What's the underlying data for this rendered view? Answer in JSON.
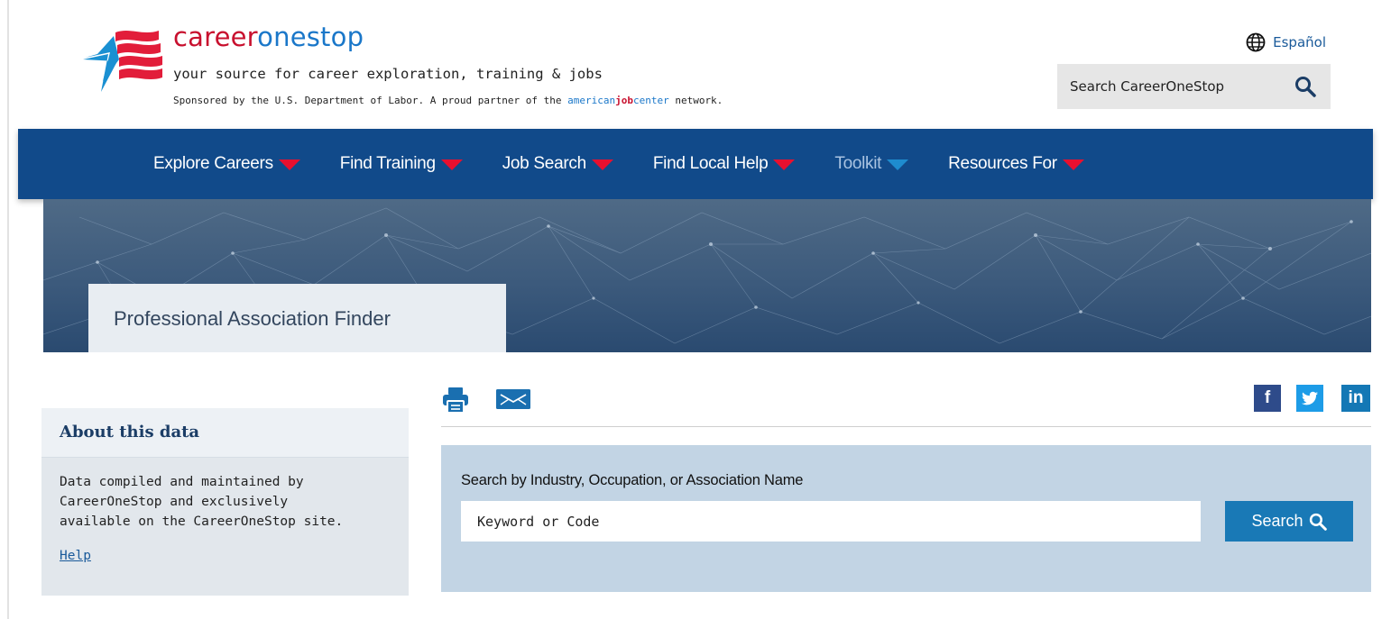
{
  "header": {
    "brand": {
      "part1": "career",
      "part2": "one",
      "part3": "stop"
    },
    "tagline": "your source for career exploration, training & jobs",
    "sponsor": {
      "prefix": "Sponsored by the U.S. Department of Labor. A proud partner of the ",
      "ajc_a": "american",
      "ajc_b": "job",
      "ajc_c": "center",
      "suffix": " network."
    },
    "language_link": "Español",
    "site_search_label": "Search CareerOneStop"
  },
  "nav": {
    "items": [
      {
        "label": "Explore Careers",
        "caret": "red"
      },
      {
        "label": "Find Training",
        "caret": "red"
      },
      {
        "label": "Job Search",
        "caret": "red"
      },
      {
        "label": "Find Local Help",
        "caret": "red"
      },
      {
        "label": "Toolkit",
        "caret": "blue"
      },
      {
        "label": "Resources For",
        "caret": "red"
      }
    ]
  },
  "banner": {
    "page_title": "Professional Association Finder"
  },
  "sidebar": {
    "title": "About this data",
    "body_line1": "Data compiled and maintained by",
    "body_line2": "CareerOneStop and exclusively",
    "body_line3": "available on the CareerOneStop site.",
    "help_link": "Help"
  },
  "toolbar": {
    "icons": [
      "print-icon",
      "email-icon"
    ],
    "social": {
      "facebook": "f",
      "twitter": "t",
      "linkedin": "in"
    }
  },
  "search": {
    "label": "Search by Industry, Occupation, or Association Name",
    "placeholder": "Keyword or Code",
    "button_label": "Search"
  },
  "colors": {
    "nav_bg": "#114a8a",
    "brand_red": "#c8102e",
    "brand_blue": "#1a77c9",
    "search_panel": "#c2d4e4",
    "search_button": "#1979b6"
  }
}
